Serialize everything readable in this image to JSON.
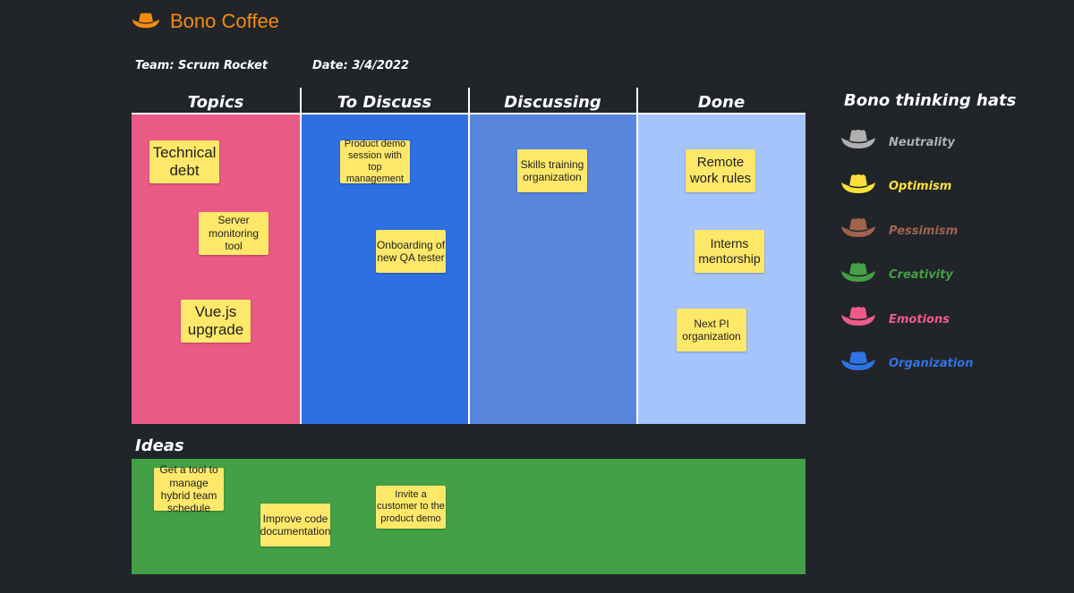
{
  "header": {
    "logo_icon": "cowboy-hat-icon",
    "logo_color": "#f28c0f",
    "title": "Bono Coffee",
    "team": "Team: Scrum Rocket",
    "date": "Date: 3/4/2022"
  },
  "board": {
    "columns": [
      {
        "title": "Topics",
        "color": "#ea5a86",
        "notes": [
          "Technical debt",
          "Server monitoring tool",
          "Vue.js upgrade"
        ]
      },
      {
        "title": "To Discuss",
        "color": "#2f6fe4",
        "notes": [
          "Product demo session with top management",
          "Onboarding of new QA tester"
        ]
      },
      {
        "title": "Discussing",
        "color": "#5886dc",
        "notes": [
          "Skills training organization"
        ]
      },
      {
        "title": "Done",
        "color": "#a6c4fc",
        "notes": [
          "Remote work rules",
          "Interns mentorship",
          "Next PI organization"
        ]
      }
    ]
  },
  "ideas": {
    "title": "Ideas",
    "color": "#43a047",
    "notes": [
      "Get a tool to manage hybrid team schedule",
      "Improve code documentation",
      "Invite a customer to the product demo"
    ]
  },
  "legend": {
    "title": "Bono thinking hats",
    "items": [
      {
        "label": "Neutrality",
        "color": "#b0b0b0",
        "icon": "cowboy-hat-icon"
      },
      {
        "label": "Optimism",
        "color": "#fde13a",
        "icon": "cowboy-hat-icon"
      },
      {
        "label": "Pessimism",
        "color": "#a0634e",
        "icon": "cowboy-hat-icon"
      },
      {
        "label": "Creativity",
        "color": "#43a047",
        "icon": "cowboy-hat-icon"
      },
      {
        "label": "Emotions",
        "color": "#ef5b88",
        "icon": "cowboy-hat-icon"
      },
      {
        "label": "Organization",
        "color": "#2f74e4",
        "icon": "cowboy-hat-icon"
      }
    ]
  }
}
